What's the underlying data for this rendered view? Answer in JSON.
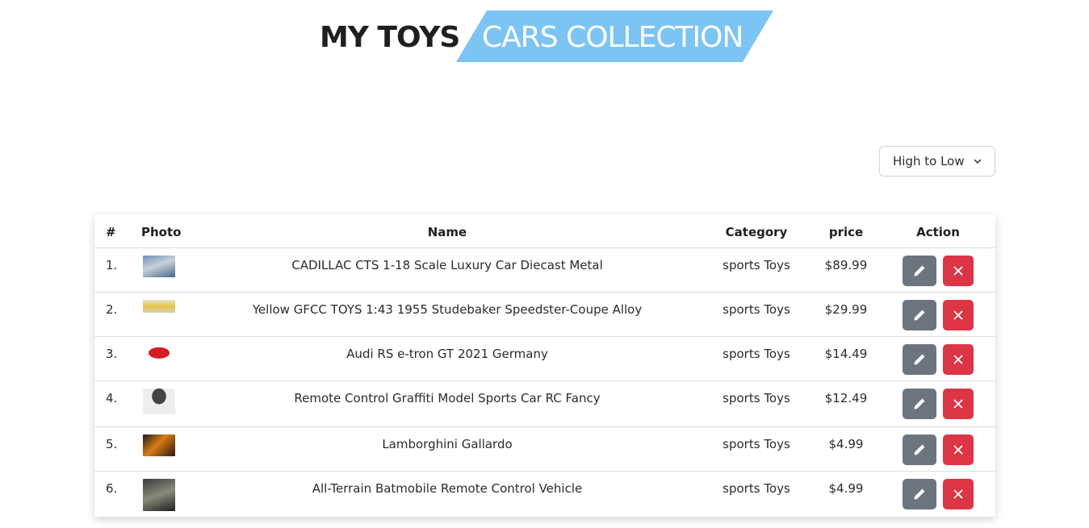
{
  "heading": {
    "left": "MY TOYS",
    "right": "CARS COLLECTION"
  },
  "sort": {
    "selected": "High to Low"
  },
  "table": {
    "headers": {
      "num": "#",
      "photo": "Photo",
      "name": "Name",
      "category": "Category",
      "price": "price",
      "action": "Action"
    },
    "rows": [
      {
        "num": "1.",
        "name": "CADILLAC CTS 1-18 Scale Luxury Car Diecast Metal",
        "category": "sports Toys",
        "price": "$89.99"
      },
      {
        "num": "2.",
        "name": "Yellow GFCC TOYS 1:43 1955 Studebaker Speedster-Coupe Alloy",
        "category": "sports Toys",
        "price": "$29.99"
      },
      {
        "num": "3.",
        "name": "Audi RS e-tron GT 2021 Germany",
        "category": "sports Toys",
        "price": "$14.49"
      },
      {
        "num": "4.",
        "name": "Remote Control Graffiti Model Sports Car RC Fancy",
        "category": "sports Toys",
        "price": "$12.49"
      },
      {
        "num": "5.",
        "name": "Lamborghini Gallardo",
        "category": "sports Toys",
        "price": "$4.99"
      },
      {
        "num": "6.",
        "name": "All-Terrain Batmobile Remote Control Vehicle",
        "category": "sports Toys",
        "price": "$4.99"
      }
    ]
  },
  "icons": {
    "edit": "pencil-icon",
    "delete": "close-icon",
    "dropdown": "chevron-down-icon"
  },
  "colors": {
    "banner": "#7cc4f3",
    "edit_button": "#6c757d",
    "delete_button": "#dc3545"
  }
}
